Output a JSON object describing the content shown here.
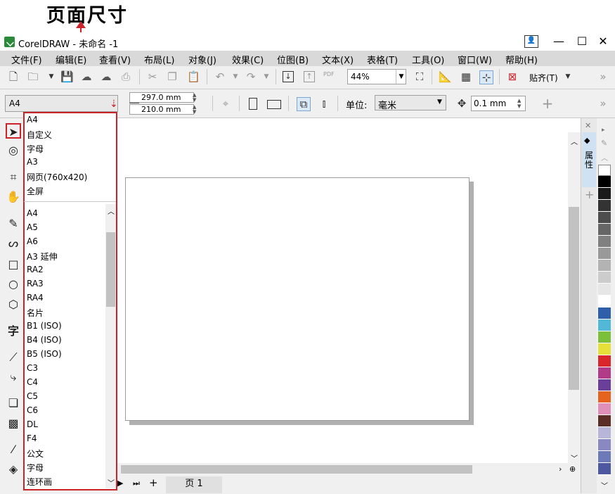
{
  "annotation": {
    "title": "页面尺寸"
  },
  "window": {
    "title": "CorelDRAW - 未命名 -1",
    "min": "▬",
    "max": "☐",
    "close": "✕"
  },
  "menu": [
    "文件(F)",
    "编辑(E)",
    "查看(V)",
    "布局(L)",
    "对象(J)",
    "效果(C)",
    "位图(B)",
    "文本(X)",
    "表格(T)",
    "工具(O)",
    "窗口(W)",
    "帮助(H)"
  ],
  "toolbar": {
    "zoom": "44%",
    "snap_label": "贴齐(T)",
    "pdf_label": "PDF"
  },
  "property_bar": {
    "page_size": "A4",
    "width": "297.0 mm",
    "height": "210.0 mm",
    "unit_label": "单位:",
    "unit_value": "毫米",
    "nudge": "0.1 mm"
  },
  "page_size_dropdown": {
    "recent": [
      "A4",
      "自定义",
      "字母",
      "A3",
      "网页(760x420)",
      "全屏"
    ],
    "all": [
      "A4",
      "A5",
      "A6",
      "A3 延伸",
      "RA2",
      "RA3",
      "RA4",
      "名片",
      "B1 (ISO)",
      "B4 (ISO)",
      "B5 (ISO)",
      "C3",
      "C4",
      "C5",
      "C6",
      "DL",
      "F4",
      "公文",
      "字母",
      "连环画"
    ]
  },
  "pagebar": {
    "page_label": "页 1"
  },
  "docker": {
    "label": "属性"
  },
  "palette": {
    "colors": [
      "#000000",
      "#1a1a1a",
      "#333333",
      "#4d4d4d",
      "#666666",
      "#808080",
      "#999999",
      "#b3b3b3",
      "#cccccc",
      "#e6e6e6",
      "#ffffff",
      "#2f5fa8",
      "#52b8d8",
      "#7cbf3a",
      "#e6e03a",
      "#d9262b",
      "#b13b87",
      "#6a3f9a",
      "#e5621f",
      "#e090b8",
      "#5a2e26",
      "#b8b6d8",
      "#8a88c0",
      "#6c7ab8",
      "#4e58a0"
    ]
  }
}
